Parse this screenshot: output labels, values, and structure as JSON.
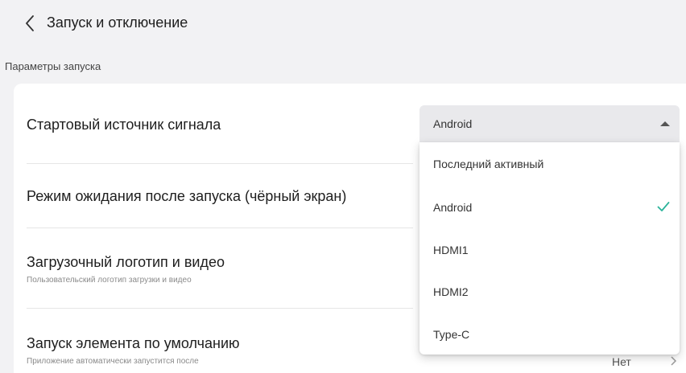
{
  "header": {
    "title": "Запуск и отключение"
  },
  "section": {
    "title": "Параметры запуска"
  },
  "rows": [
    {
      "label": "Стартовый источник сигнала",
      "sub": ""
    },
    {
      "label": "Режим ожидания после запуска (чёрный экран)",
      "sub": ""
    },
    {
      "label": "Загрузочный логотип и видео",
      "sub": "Пользовательский логотип загрузки и видео"
    },
    {
      "label": "Запуск элемента по умолчанию",
      "sub": "Приложение автоматически запустится после",
      "value": "Нет"
    }
  ],
  "select": {
    "value": "Android",
    "options": [
      {
        "label": "Последний активный",
        "selected": false
      },
      {
        "label": "Android",
        "selected": true
      },
      {
        "label": "HDMI1",
        "selected": false
      },
      {
        "label": "HDMI2",
        "selected": false
      },
      {
        "label": "Type-C",
        "selected": false
      }
    ]
  },
  "colors": {
    "accent": "#2bb39a",
    "background": "#f2f2f4",
    "card": "#ffffff"
  },
  "icons": {
    "back": "chevron-left-icon",
    "caret": "caret-up-icon",
    "check": "check-icon",
    "forward": "chevron-right-icon"
  }
}
